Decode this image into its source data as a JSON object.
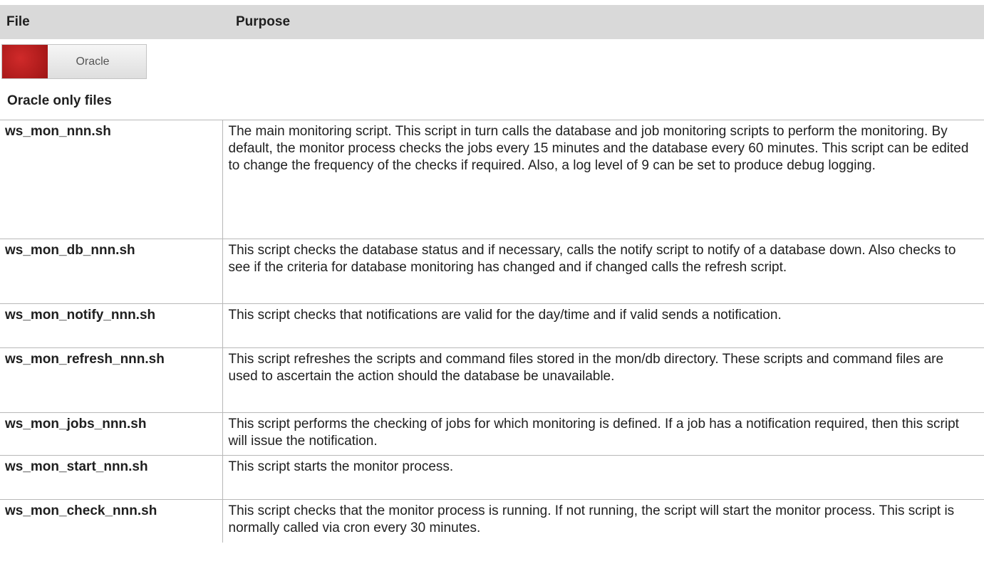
{
  "table": {
    "headers": {
      "file": "File",
      "purpose": "Purpose"
    },
    "oracle_badge": {
      "label": "Oracle",
      "color": "#b81c1c"
    },
    "section_title": "Oracle only files",
    "rows": [
      {
        "file": "ws_mon_nnn.sh",
        "purpose": "The main monitoring script. This script in turn calls the database and job monitoring scripts to perform the monitoring. By default, the monitor process checks the jobs every 15 minutes and the database every 60 minutes. This script can be edited to change the frequency of the checks if required. Also, a log level of 9 can be set to produce debug logging."
      },
      {
        "file": "ws_mon_db_nnn.sh",
        "purpose": "This script checks the database status and if necessary, calls the notify script to notify of a database down. Also checks to see if the criteria for database monitoring has changed and if changed calls the refresh script."
      },
      {
        "file": "ws_mon_notify_nnn.sh",
        "purpose": "This script checks that notifications are valid for the day/time and if valid sends a notification."
      },
      {
        "file": "ws_mon_refresh_nnn.sh",
        "purpose": "This script refreshes the scripts and command files stored in the mon/db directory. These scripts and command files are used to ascertain the action should the database be unavailable."
      },
      {
        "file": "ws_mon_jobs_nnn.sh",
        "purpose": "This script performs the checking of jobs for which monitoring is defined. If a job has a notification required, then this script will issue the notification."
      },
      {
        "file": "ws_mon_start_nnn.sh",
        "purpose": "This script starts the monitor process."
      },
      {
        "file": "ws_mon_check_nnn.sh",
        "purpose": "This script checks that the monitor process is running. If not running, the script will start the monitor process. This script is normally called via cron every 30 minutes."
      }
    ]
  }
}
